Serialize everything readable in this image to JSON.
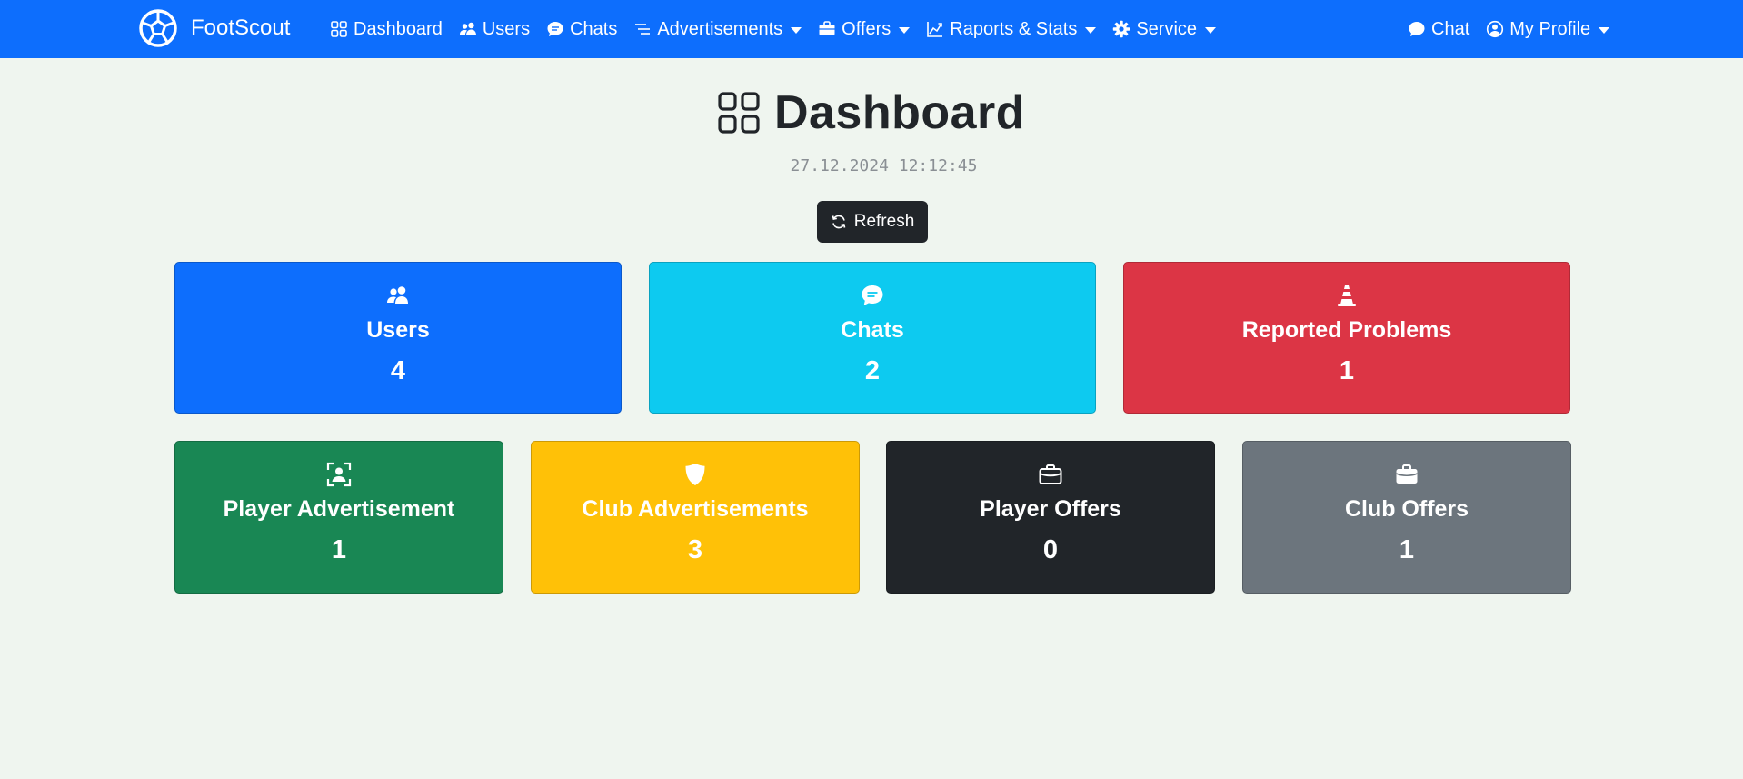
{
  "colors": {
    "navbar": "#0d6efd",
    "page_bg": "#eff5ef",
    "primary": "#0d6efd",
    "info": "#0dcaf0",
    "danger": "#dc3545",
    "success": "#198754",
    "warning": "#ffc107",
    "dark": "#212529",
    "secondary": "#6c757d"
  },
  "navbar": {
    "brand": {
      "label": "FootScout",
      "icon": "soccer-ball-icon"
    },
    "items": [
      {
        "label": "Dashboard",
        "icon": "grid-icon",
        "dropdown": false
      },
      {
        "label": "Users",
        "icon": "people-icon",
        "dropdown": false
      },
      {
        "label": "Chats",
        "icon": "chat-icon",
        "dropdown": false
      },
      {
        "label": "Advertisements",
        "icon": "list-icon",
        "dropdown": true
      },
      {
        "label": "Offers",
        "icon": "briefcase-icon",
        "dropdown": true
      },
      {
        "label": "Raports & Stats",
        "icon": "graph-icon",
        "dropdown": true
      },
      {
        "label": "Service",
        "icon": "gear-icon",
        "dropdown": true
      }
    ],
    "right": [
      {
        "label": "Chat",
        "icon": "chat-icon",
        "dropdown": false
      },
      {
        "label": "My Profile",
        "icon": "person-circle-icon",
        "dropdown": true
      }
    ]
  },
  "header": {
    "title": "Dashboard",
    "timestamp": "27.12.2024 12:12:45",
    "refresh_label": "Refresh"
  },
  "cards": [
    {
      "title": "Users",
      "value": "4",
      "icon": "people-icon",
      "color": "primary"
    },
    {
      "title": "Chats",
      "value": "2",
      "icon": "chat-icon",
      "color": "info"
    },
    {
      "title": "Reported Problems",
      "value": "1",
      "icon": "cone-icon",
      "color": "danger"
    },
    {
      "title": "Player Advertisement",
      "value": "1",
      "icon": "person-bounding-box-icon",
      "color": "success"
    },
    {
      "title": "Club Advertisements",
      "value": "3",
      "icon": "shield-icon",
      "color": "warning"
    },
    {
      "title": "Player Offers",
      "value": "0",
      "icon": "briefcase-outline-icon",
      "color": "dark"
    },
    {
      "title": "Club Offers",
      "value": "1",
      "icon": "briefcase-fill-icon",
      "color": "secondary"
    }
  ]
}
